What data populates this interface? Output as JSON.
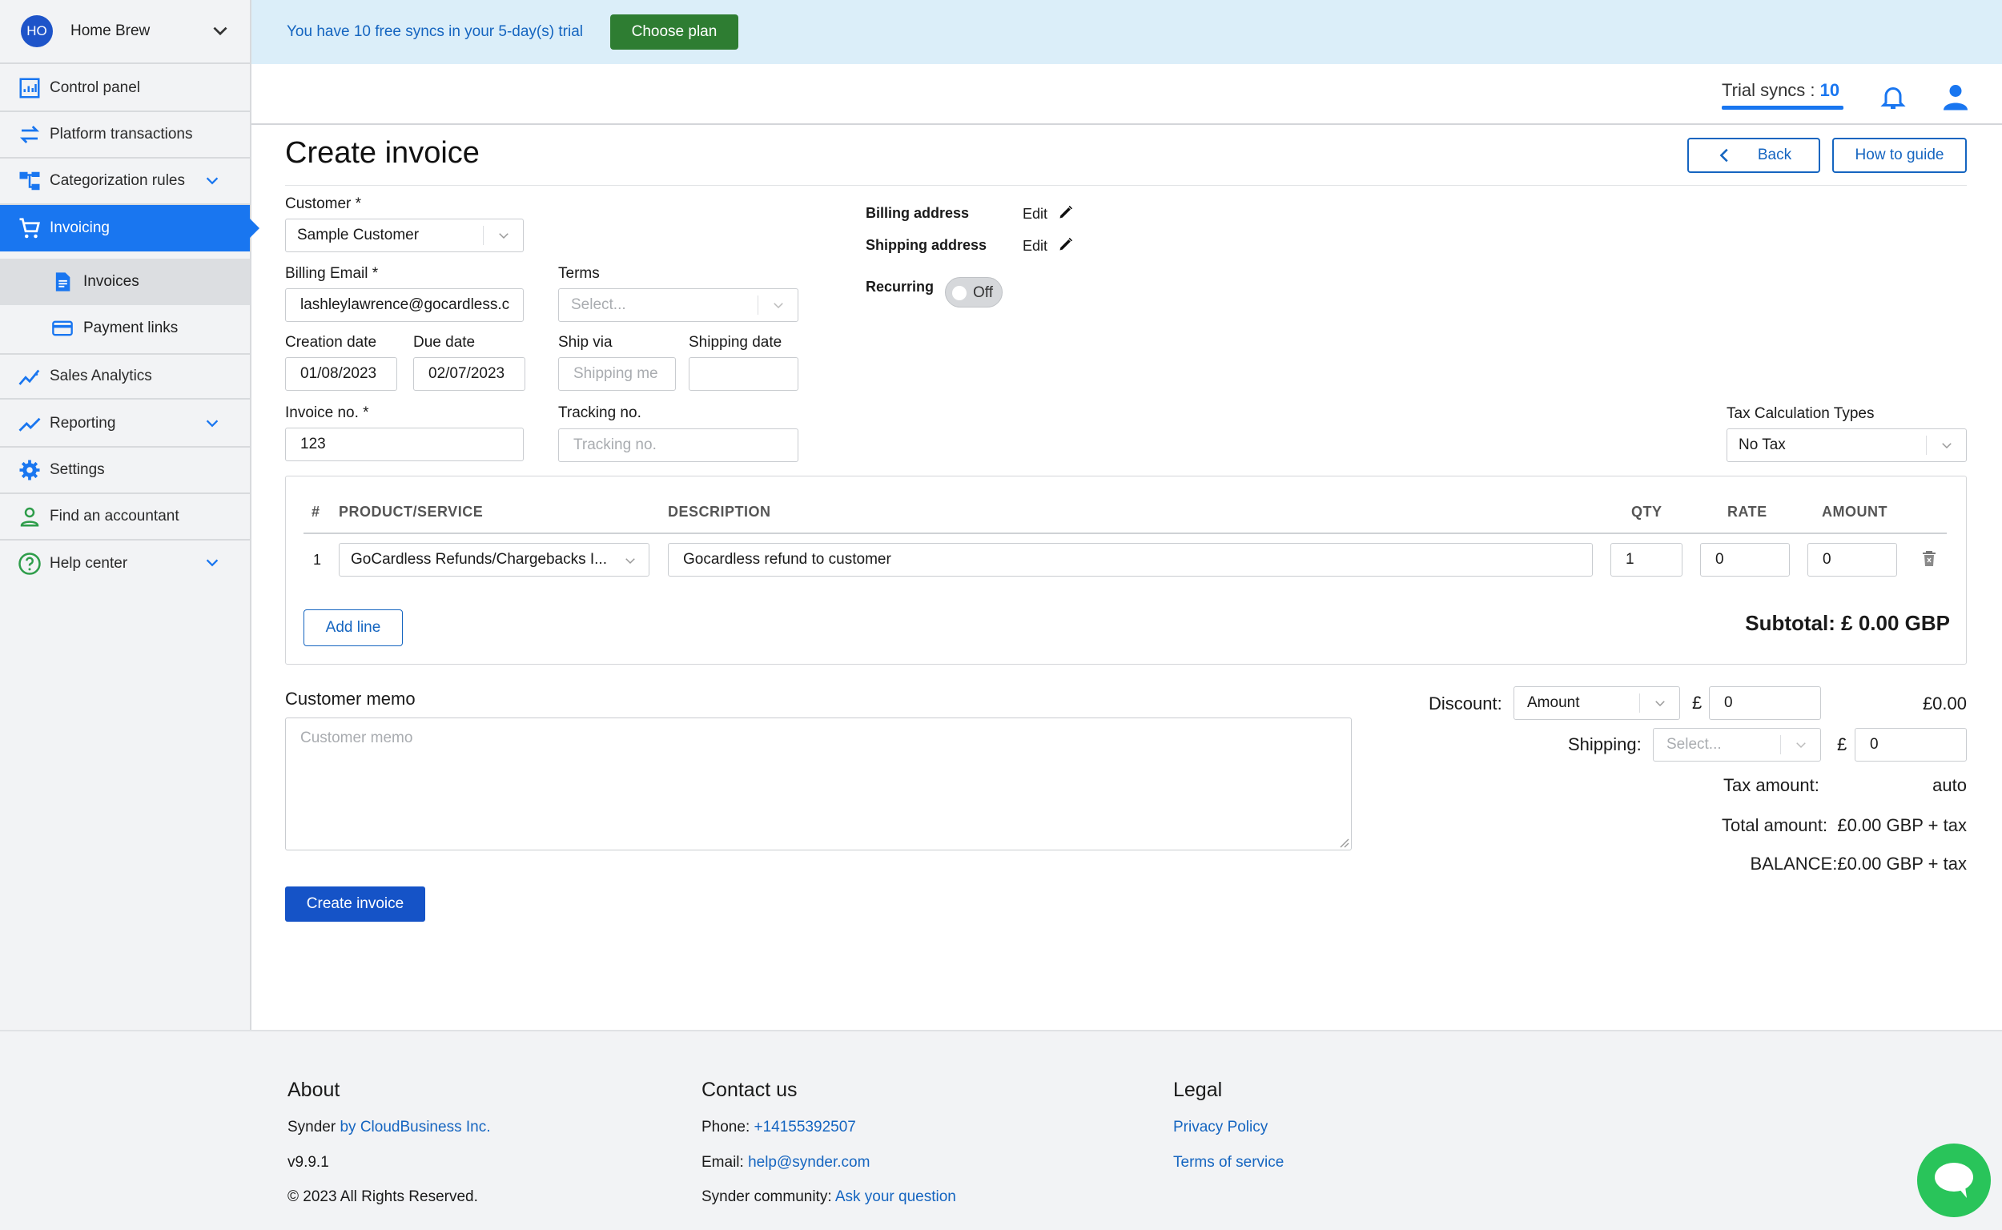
{
  "org": {
    "initials": "HO",
    "name": "Home Brew"
  },
  "nav": {
    "control_panel": "Control panel",
    "platform_transactions": "Platform transactions",
    "categorization_rules": "Categorization rules",
    "invoicing": "Invoicing",
    "invoices": "Invoices",
    "payment_links": "Payment links",
    "sales_analytics": "Sales Analytics",
    "reporting": "Reporting",
    "settings": "Settings",
    "find_accountant": "Find an accountant",
    "help_center": "Help center"
  },
  "banner": {
    "text": "You have 10 free syncs in your 5-day(s) trial",
    "button": "Choose plan"
  },
  "topbar": {
    "trial_label": "Trial syncs : ",
    "trial_count": "10"
  },
  "page": {
    "title": "Create invoice",
    "back": "Back",
    "guide": "How to guide"
  },
  "form": {
    "customer_label": "Customer *",
    "customer_value": "Sample Customer",
    "billing_email_label": "Billing Email *",
    "billing_email_value": "lashleylawrence@gocardless.c",
    "terms_label": "Terms",
    "terms_placeholder": "Select...",
    "creation_date_label": "Creation date",
    "creation_date_value": "01/08/2023",
    "due_date_label": "Due date",
    "due_date_value": "02/07/2023",
    "ship_via_label": "Ship via",
    "ship_via_placeholder": "Shipping me",
    "shipping_date_label": "Shipping date",
    "invoice_no_label": "Invoice no. *",
    "invoice_no_value": "123",
    "tracking_label": "Tracking no.",
    "tracking_placeholder": "Tracking no.",
    "billing_address_label": "Billing address",
    "shipping_address_label": "Shipping address",
    "edit": "Edit",
    "recurring_label": "Recurring",
    "recurring_value": "Off",
    "tax_type_label": "Tax Calculation Types",
    "tax_type_value": "No Tax"
  },
  "items": {
    "headers": {
      "num": "#",
      "product": "PRODUCT/SERVICE",
      "description": "DESCRIPTION",
      "qty": "QTY",
      "rate": "RATE",
      "amount": "AMOUNT"
    },
    "rows": [
      {
        "num": "1",
        "product": "GoCardless Refunds/Chargebacks I...",
        "description": "Gocardless refund to customer",
        "qty": "1",
        "rate": "0",
        "amount": "0"
      }
    ],
    "add_line": "Add line",
    "subtotal": "Subtotal: £ 0.00 GBP"
  },
  "memo": {
    "label": "Customer memo",
    "placeholder": "Customer memo"
  },
  "totals": {
    "discount_label": "Discount:",
    "discount_type": "Amount",
    "currency": "£",
    "discount_value": "0",
    "discount_total": "£0.00",
    "shipping_label": "Shipping:",
    "shipping_placeholder": "Select...",
    "shipping_value": "0",
    "tax_label": "Tax amount:",
    "tax_value": "auto",
    "total_label": "Total amount:",
    "total_value": "£0.00 GBP + tax",
    "balance_label": "BALANCE:",
    "balance_value": "£0.00 GBP + tax"
  },
  "create_button": "Create invoice",
  "footer": {
    "about_title": "About",
    "synder": "Synder ",
    "by": "by CloudBusiness Inc.",
    "version": "v9.9.1",
    "rights": "© 2023 All Rights Reserved.",
    "contact_title": "Contact us",
    "phone_label": "Phone: ",
    "phone": "+14155392507",
    "email_label": "Email: ",
    "email": "help@synder.com",
    "community_label": "Synder community: ",
    "community_link": "Ask your question",
    "legal_title": "Legal",
    "privacy": "Privacy Policy",
    "terms": "Terms of service"
  }
}
